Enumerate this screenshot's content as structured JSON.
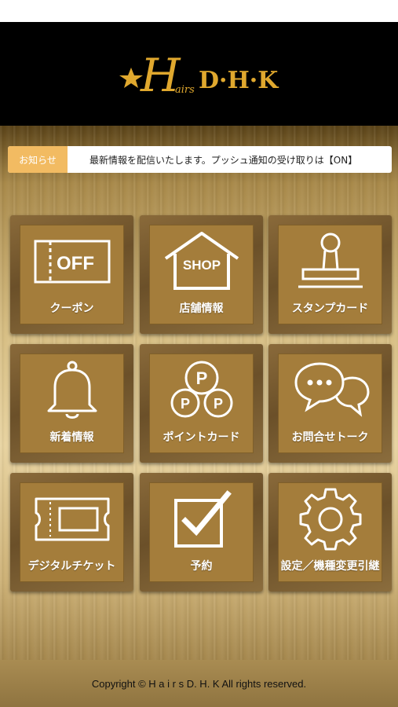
{
  "app": {
    "logo_text": "HairsD·H·K"
  },
  "notice": {
    "badge": "お知らせ",
    "text": "最新情報を配信いたします。プッシュ通知の受け取りは【ON】"
  },
  "menu": [
    {
      "label": "クーポン",
      "icon": "coupon-off-icon",
      "icon_text": "OFF"
    },
    {
      "label": "店舗情報",
      "icon": "shop-icon",
      "icon_text": "SHOP"
    },
    {
      "label": "スタンプカード",
      "icon": "stamp-icon"
    },
    {
      "label": "新着情報",
      "icon": "bell-icon"
    },
    {
      "label": "ポイントカード",
      "icon": "point-icon",
      "icon_text": "P"
    },
    {
      "label": "お問合せトーク",
      "icon": "chat-bubbles-icon"
    },
    {
      "label": "デジタルチケット",
      "icon": "ticket-icon"
    },
    {
      "label": "予約",
      "icon": "checkbox-icon"
    },
    {
      "label": "設定／機種変更引継",
      "icon": "gear-icon"
    }
  ],
  "footer": {
    "copyright": "Copyright © H a i r s D. H. K All rights reserved."
  },
  "colors": {
    "header_bg": "#000000",
    "logo_gold": "#e0a82e",
    "notice_badge": "#f2bb62",
    "tile_inner": "#a47d3b"
  }
}
